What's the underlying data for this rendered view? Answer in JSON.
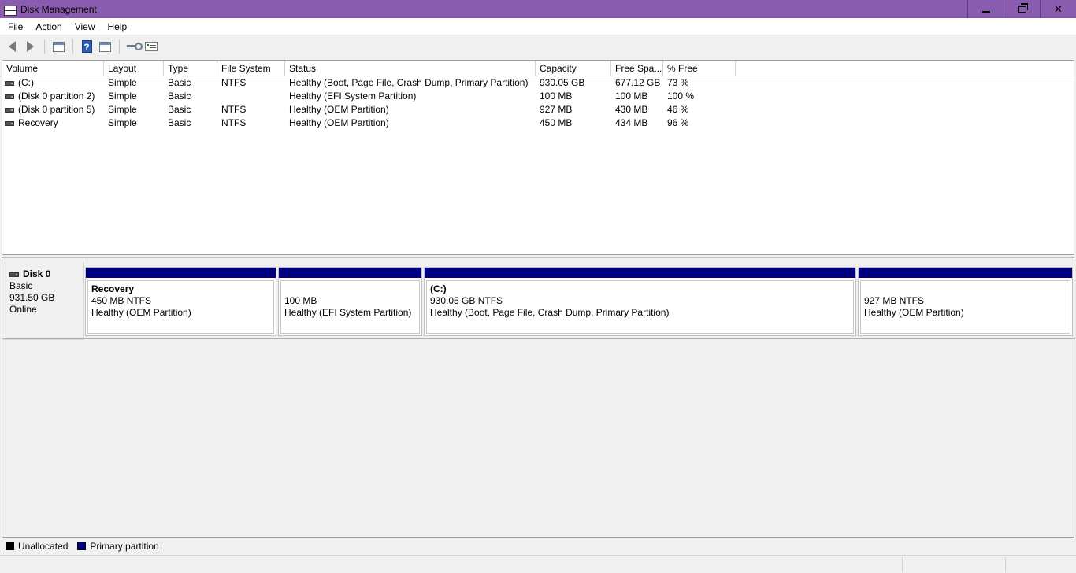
{
  "window": {
    "title": "Disk Management",
    "controls": {
      "minimize": "minimize",
      "restore": "restore",
      "close": "✕"
    }
  },
  "menu": [
    "File",
    "Action",
    "View",
    "Help"
  ],
  "toolbar": {
    "icons": [
      "back-arrow-icon",
      "forward-arrow-icon",
      "console-tree-icon",
      "help-icon",
      "properties-icon",
      "connect-icon",
      "list-view-icon"
    ]
  },
  "volume_list": {
    "columns": [
      "Volume",
      "Layout",
      "Type",
      "File System",
      "Status",
      "Capacity",
      "Free Spa...",
      "% Free"
    ],
    "rows": [
      {
        "volume": " (C:)",
        "layout": "Simple",
        "type": "Basic",
        "fs": "NTFS",
        "status": "Healthy (Boot, Page File, Crash Dump, Primary Partition)",
        "capacity": "930.05 GB",
        "free": "677.12 GB",
        "pct": "73 %"
      },
      {
        "volume": "(Disk 0 partition 2)",
        "layout": "Simple",
        "type": "Basic",
        "fs": "",
        "status": "Healthy (EFI System Partition)",
        "capacity": "100 MB",
        "free": "100 MB",
        "pct": "100 %"
      },
      {
        "volume": "(Disk 0 partition 5)",
        "layout": "Simple",
        "type": "Basic",
        "fs": "NTFS",
        "status": "Healthy (OEM Partition)",
        "capacity": "927 MB",
        "free": "430 MB",
        "pct": "46 %"
      },
      {
        "volume": "Recovery",
        "layout": "Simple",
        "type": "Basic",
        "fs": "NTFS",
        "status": "Healthy (OEM Partition)",
        "capacity": "450 MB",
        "free": "434 MB",
        "pct": "96 %"
      }
    ]
  },
  "disk": {
    "name": "Disk 0",
    "type": "Basic",
    "size": "931.50 GB",
    "state": "Online",
    "partitions": [
      {
        "name": "Recovery",
        "size": "450 MB NTFS",
        "status": "Healthy (OEM Partition)"
      },
      {
        "name": "",
        "size": "100 MB",
        "status": "Healthy (EFI System Partition)"
      },
      {
        "name": "(C:)",
        "size": "930.05 GB NTFS",
        "status": "Healthy (Boot, Page File, Crash Dump, Primary Partition)"
      },
      {
        "name": "",
        "size": "927 MB NTFS",
        "status": "Healthy (OEM Partition)"
      }
    ]
  },
  "legend": [
    {
      "label": "Unallocated",
      "color": "#000000"
    },
    {
      "label": "Primary partition",
      "color": "#00007f"
    }
  ]
}
